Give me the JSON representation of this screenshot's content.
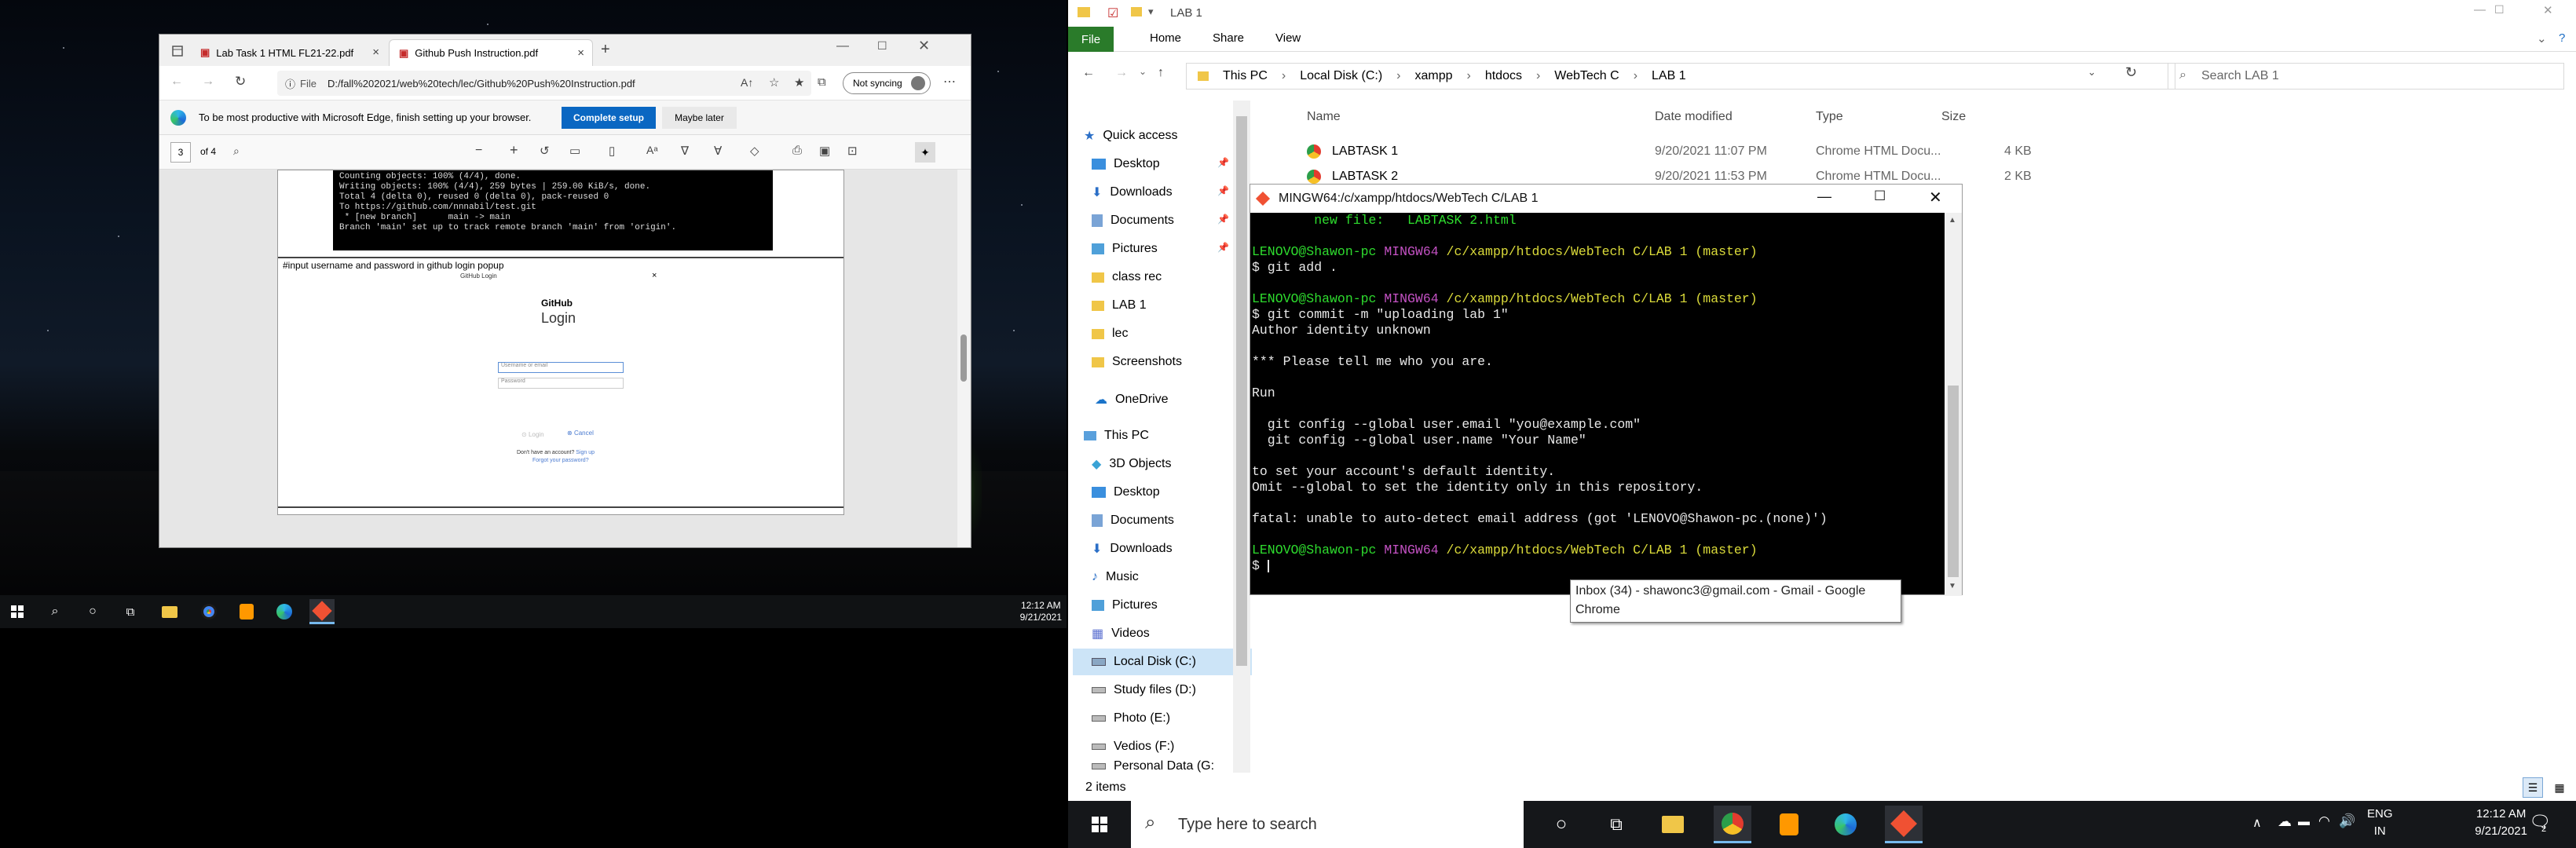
{
  "left_monitor": {
    "taskbar": {
      "time": "12:12 AM",
      "date": "9/21/2021"
    }
  },
  "edge": {
    "tabs": [
      {
        "label": "Lab Task 1 HTML FL21-22.pdf"
      },
      {
        "label": "Github Push Instruction.pdf"
      }
    ],
    "url_prefix": "File",
    "url": "D:/fall%202021/web%20tech/lec/Github%20Push%20Instruction.pdf",
    "sync_label": "Not syncing",
    "infobar_text": "To be most productive with Microsoft Edge, finish setting up your browser.",
    "complete_setup": "Complete setup",
    "maybe_later": "Maybe later",
    "pdf": {
      "page": "3",
      "of_pages": "of 4",
      "terminal_lines": [
        "Counting objects: 100% (4/4), done.",
        "Writing objects: 100% (4/4), 259 bytes | 259.00 KiB/s, done.",
        "Total 4 (delta 0), reused 0 (delta 0), pack-reused 0",
        "To https://github.com/nnnabil/test.git",
        " * [new branch]      main -> main",
        "Branch 'main' set up to track remote branch 'main' from 'origin'."
      ],
      "section_heading": "#input username and password in github login popup",
      "popup_title": "GitHub Login",
      "github_label": "GitHub",
      "login_label": "Login",
      "username_placeholder": "Username or email",
      "password_placeholder": "Password",
      "login_btn": "Login",
      "cancel_btn": "Cancel",
      "no_account": "Don't have an account?",
      "sign_up": "Sign up",
      "forgot": "Forgot your password?"
    }
  },
  "explorer": {
    "title": "LAB 1",
    "ribbon": {
      "file": "File",
      "home": "Home",
      "share": "Share",
      "view": "View"
    },
    "breadcrumb": [
      "This PC",
      "Local Disk (C:)",
      "xampp",
      "htdocs",
      "WebTech C",
      "LAB 1"
    ],
    "search_placeholder": "Search LAB 1",
    "nav": {
      "quick_access": "Quick access",
      "quick_items": [
        "Desktop",
        "Downloads",
        "Documents",
        "Pictures",
        "class rec",
        "LAB 1",
        "lec",
        "Screenshots"
      ],
      "onedrive": "OneDrive",
      "this_pc": "This PC",
      "pc_items": [
        "3D Objects",
        "Desktop",
        "Documents",
        "Downloads",
        "Music",
        "Pictures",
        "Videos",
        "Local Disk (C:)",
        "Study files (D:)",
        "Photo (E:)",
        "Vedios (F:)",
        "Personal Data (G:"
      ]
    },
    "columns": {
      "name": "Name",
      "date": "Date modified",
      "type": "Type",
      "size": "Size"
    },
    "files": [
      {
        "name": "LABTASK 1",
        "date": "9/20/2021 11:07 PM",
        "type": "Chrome HTML Docu...",
        "size": "4 KB"
      },
      {
        "name": "LABTASK 2",
        "date": "9/20/2021 11:53 PM",
        "type": "Chrome HTML Docu...",
        "size": "2 KB"
      }
    ],
    "status": "2 items"
  },
  "bash": {
    "title": "MINGW64:/c/xampp/htdocs/WebTech C/LAB 1",
    "lines": [
      {
        "parts": [
          {
            "t": "        new file:   LABTASK 2.html",
            "c": "cg"
          }
        ]
      },
      {
        "parts": [
          {
            "t": "",
            "c": ""
          }
        ]
      },
      {
        "parts": [
          {
            "t": "LENOVO@Shawon-pc ",
            "c": "cg"
          },
          {
            "t": "MINGW64 ",
            "c": "cm"
          },
          {
            "t": "/c/xampp/htdocs/WebTech C/LAB 1 (master)",
            "c": "cy"
          }
        ]
      },
      {
        "parts": [
          {
            "t": "$ git add .",
            "c": ""
          }
        ]
      },
      {
        "parts": [
          {
            "t": "",
            "c": ""
          }
        ]
      },
      {
        "parts": [
          {
            "t": "LENOVO@Shawon-pc ",
            "c": "cg"
          },
          {
            "t": "MINGW64 ",
            "c": "cm"
          },
          {
            "t": "/c/xampp/htdocs/WebTech C/LAB 1 (master)",
            "c": "cy"
          }
        ]
      },
      {
        "parts": [
          {
            "t": "$ git commit -m \"uploading lab 1\"",
            "c": ""
          }
        ]
      },
      {
        "parts": [
          {
            "t": "Author identity unknown",
            "c": ""
          }
        ]
      },
      {
        "parts": [
          {
            "t": "",
            "c": ""
          }
        ]
      },
      {
        "parts": [
          {
            "t": "*** Please tell me who you are.",
            "c": ""
          }
        ]
      },
      {
        "parts": [
          {
            "t": "",
            "c": ""
          }
        ]
      },
      {
        "parts": [
          {
            "t": "Run",
            "c": ""
          }
        ]
      },
      {
        "parts": [
          {
            "t": "",
            "c": ""
          }
        ]
      },
      {
        "parts": [
          {
            "t": "  git config --global user.email \"you@example.com\"",
            "c": ""
          }
        ]
      },
      {
        "parts": [
          {
            "t": "  git config --global user.name \"Your Name\"",
            "c": ""
          }
        ]
      },
      {
        "parts": [
          {
            "t": "",
            "c": ""
          }
        ]
      },
      {
        "parts": [
          {
            "t": "to set your account's default identity.",
            "c": ""
          }
        ]
      },
      {
        "parts": [
          {
            "t": "Omit --global to set the identity only in this repository.",
            "c": ""
          }
        ]
      },
      {
        "parts": [
          {
            "t": "",
            "c": ""
          }
        ]
      },
      {
        "parts": [
          {
            "t": "fatal: unable to auto-detect email address (got 'LENOVO@Shawon-pc.(none)')",
            "c": ""
          }
        ]
      },
      {
        "parts": [
          {
            "t": "",
            "c": ""
          }
        ]
      },
      {
        "parts": [
          {
            "t": "LENOVO@Shawon-pc ",
            "c": "cg"
          },
          {
            "t": "MINGW64 ",
            "c": "cm"
          },
          {
            "t": "/c/xampp/htdocs/WebTech C/LAB 1 (master)",
            "c": "cy"
          }
        ]
      },
      {
        "parts": [
          {
            "t": "$ ",
            "c": ""
          }
        ]
      }
    ]
  },
  "tooltip": "Inbox (34) - shawonc3@gmail.com - Gmail - Google Chrome",
  "right_taskbar": {
    "search_placeholder": "Type here to search",
    "lang": "ENG",
    "region": "IN",
    "time": "12:12 AM",
    "date": "9/21/2021",
    "notif_count": "2"
  }
}
